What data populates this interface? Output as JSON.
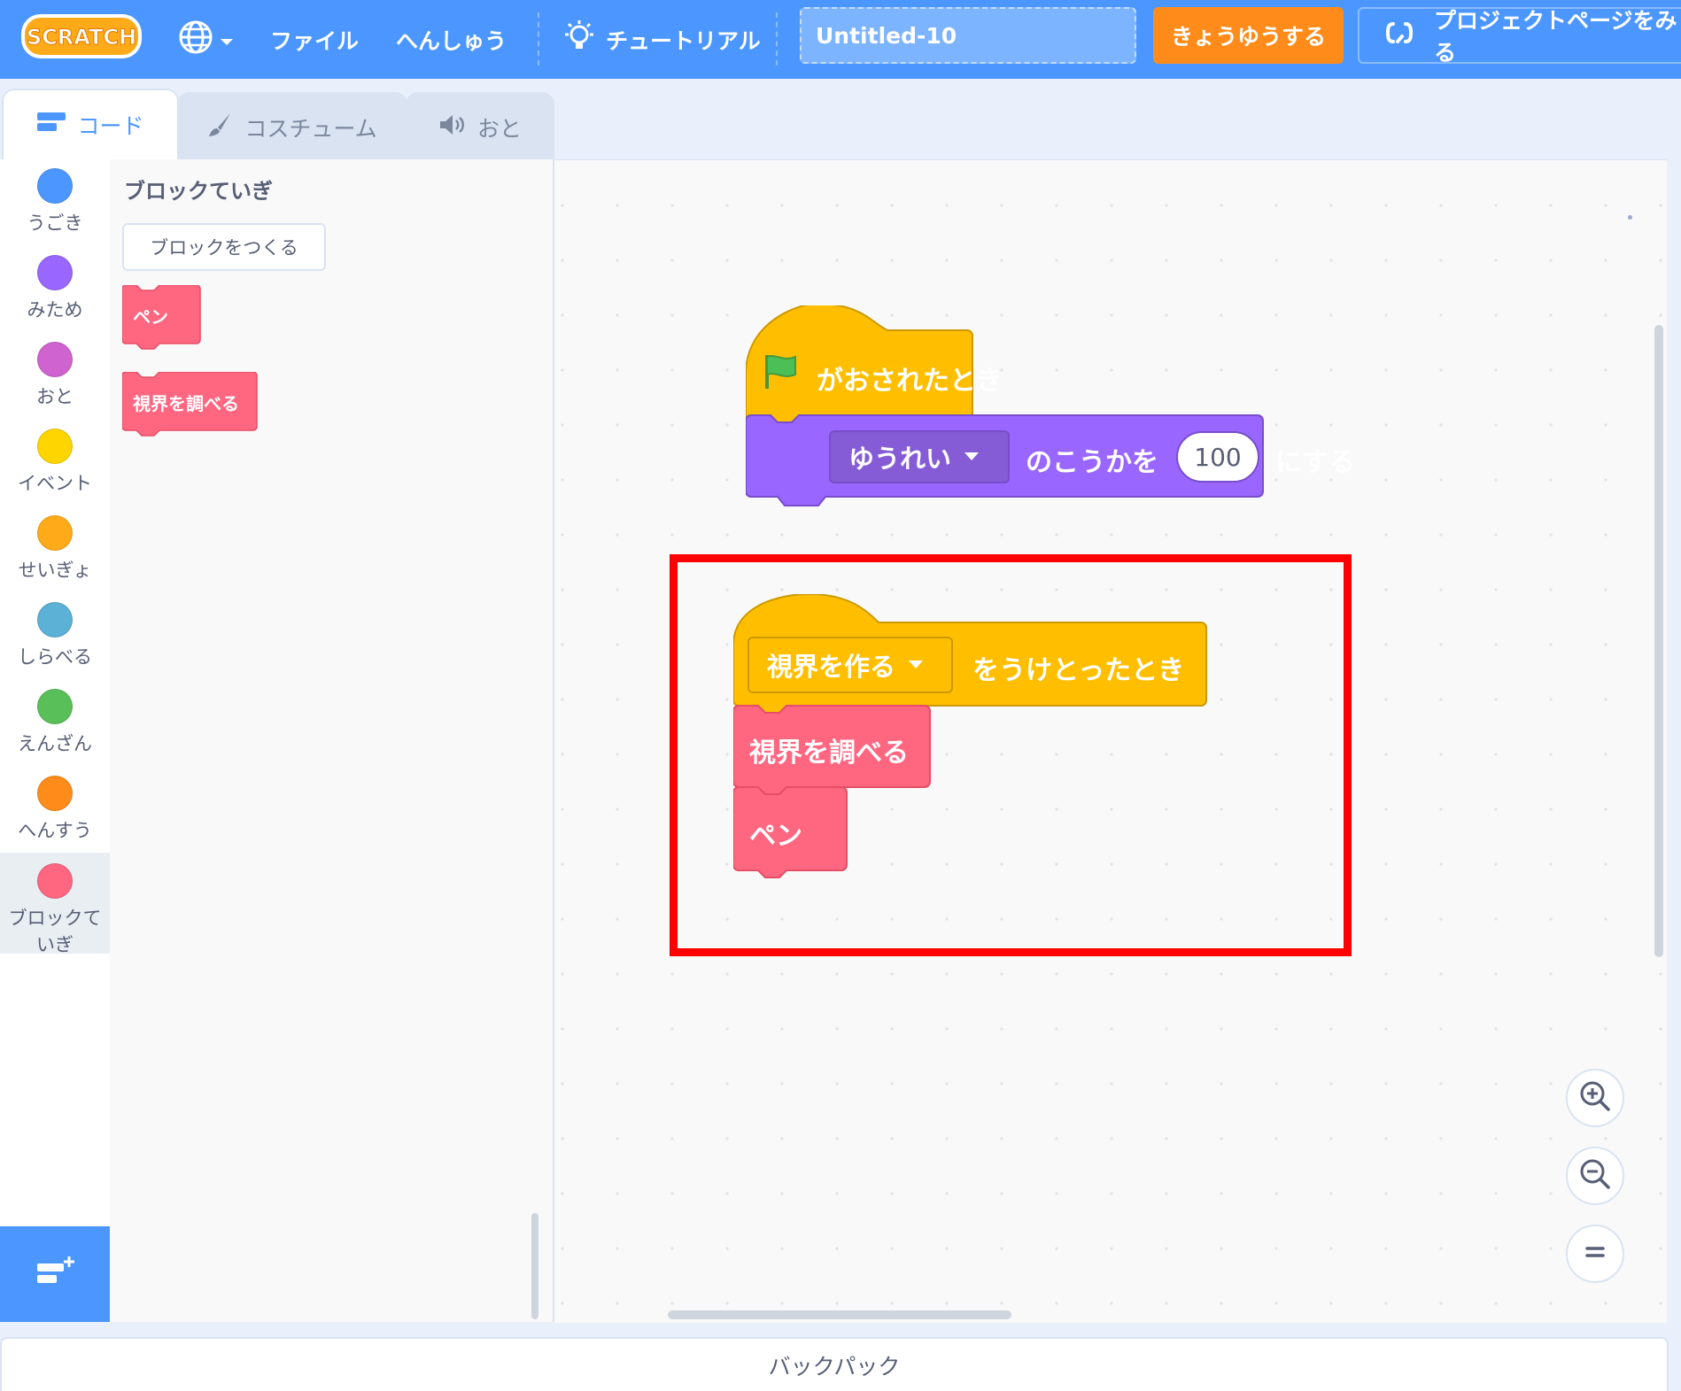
{
  "menu": {
    "logo_text": "SCRATCH",
    "file": "ファイル",
    "edit": "へんしゅう",
    "tutorial": "チュートリアル",
    "project_title": "Untitled-10",
    "share": "きょうゆうする",
    "project_page": "プロジェクトページをみる"
  },
  "tabs": [
    {
      "label": "コード"
    },
    {
      "label": "コスチューム"
    },
    {
      "label": "おと"
    }
  ],
  "categories": [
    {
      "label": "うごき",
      "color": "#4c97ff"
    },
    {
      "label": "みため",
      "color": "#9966ff"
    },
    {
      "label": "おと",
      "color": "#cf63cf"
    },
    {
      "label": "イベント",
      "color": "#ffd500"
    },
    {
      "label": "せいぎょ",
      "color": "#ffab19"
    },
    {
      "label": "しらべる",
      "color": "#5cb1d6"
    },
    {
      "label": "えんざん",
      "color": "#59c059"
    },
    {
      "label": "へんすう",
      "color": "#ff8c1a"
    },
    {
      "label_line1": "ブロックて",
      "label_line2": "いぎ",
      "color": "#ff6680"
    }
  ],
  "palette": {
    "title": "ブロックていぎ",
    "make_block": "ブロックをつくる",
    "blocks": [
      "ペン",
      "視界を調べる"
    ]
  },
  "script1": {
    "hat_label": "がおされたとき",
    "effect_dropdown": "ゆうれい",
    "effect_mid": "のこうかを",
    "effect_value": "100",
    "effect_end": "にする"
  },
  "script2": {
    "message_dropdown": "視界を作る",
    "hat_end": "をうけとったとき",
    "call1": "視界を調べる",
    "call2": "ペン"
  },
  "backpack": "バックパック",
  "colors": {
    "menu_bar": "#4c97ff",
    "events": "#ffbf00",
    "looks": "#9966ff",
    "custom_blocks": "#ff6680",
    "share": "#ff8c1a",
    "highlight": "#ff0000"
  }
}
